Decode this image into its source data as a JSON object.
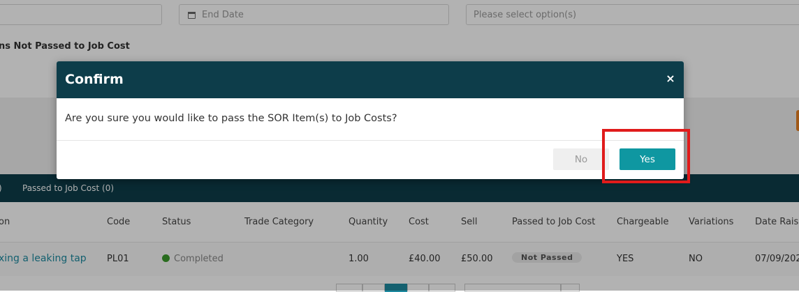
{
  "filters": {
    "end_date_placeholder": "End Date",
    "select_placeholder": "Please select option(s)"
  },
  "section_label": "ns Not Passed to Job Cost",
  "tabs": {
    "fragment": ")",
    "passed_to_job_cost": "Passed to Job Cost  (0)"
  },
  "table": {
    "headers": [
      "on",
      "Code",
      "Status",
      "Trade Category",
      "Quantity",
      "Cost",
      "Sell",
      "Passed to Job Cost",
      "Chargeable",
      "Variations",
      "Date Raise"
    ],
    "row": {
      "description": "xing a leaking tap",
      "code": "PL01",
      "status": "Completed",
      "trade_category": "",
      "quantity": "1.00",
      "cost": "£40.00",
      "sell": "£50.00",
      "passed": "Not Passed",
      "chargeable": "YES",
      "variations": "NO",
      "date_raised": "07/09/202"
    }
  },
  "modal": {
    "title": "Confirm",
    "close_symbol": "×",
    "message": "Are you sure you would like to pass the SOR Item(s) to Job Costs?",
    "no_label": "No",
    "yes_label": "Yes"
  },
  "colors": {
    "header_dark_teal": "#0d3d4a",
    "primary_button": "#0f97a1",
    "highlight_red": "#e01b1b",
    "status_green": "#3c9b2c"
  }
}
